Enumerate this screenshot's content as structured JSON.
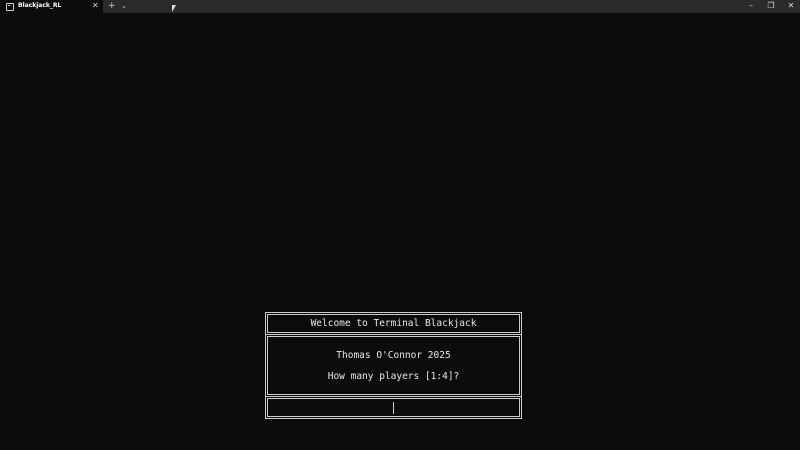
{
  "window": {
    "tab_title": "Blackjack_RL",
    "tab_close": "✕",
    "new_tab": "+",
    "tab_dropdown": "⌄",
    "controls": {
      "minimize": "–",
      "maximize": "❐",
      "close": "✕"
    }
  },
  "dialog": {
    "title": "Welcome to Terminal Blackjack",
    "author_line": "Thomas O'Connor 2025",
    "prompt": "How many players [1:4]?",
    "input_value": ""
  }
}
